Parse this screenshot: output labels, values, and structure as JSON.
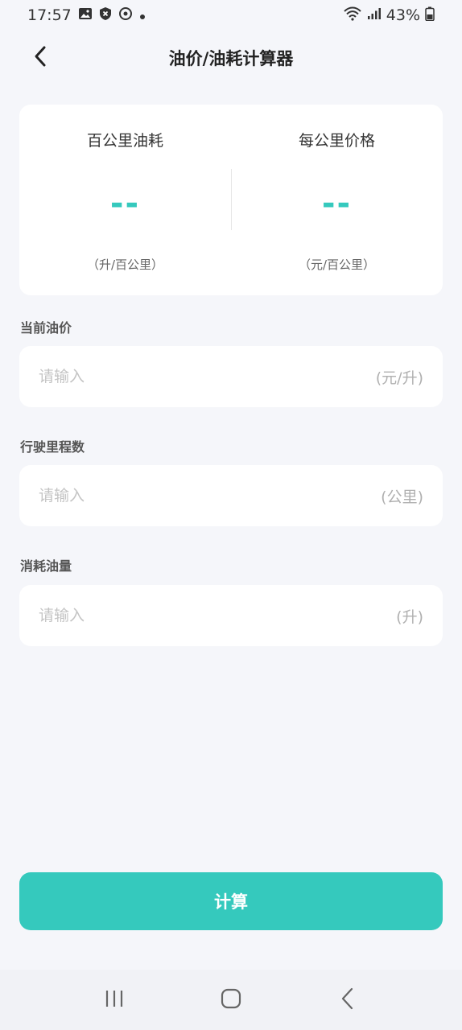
{
  "status_bar": {
    "time": "17:57",
    "battery": "43%",
    "icons": [
      "image-icon",
      "shield-icon",
      "sync-icon",
      "dot-icon",
      "wifi-icon",
      "signal-icon",
      "battery-icon"
    ]
  },
  "header": {
    "title": "油价/油耗计算器",
    "back_icon": "chevron-left-icon"
  },
  "results": {
    "consumption": {
      "label": "百公里油耗",
      "value": "--",
      "unit": "（升/百公里）"
    },
    "price": {
      "label": "每公里价格",
      "value": "--",
      "unit": "（元/百公里）"
    }
  },
  "fields": [
    {
      "label": "当前油价",
      "placeholder": "请输入",
      "unit": "(元/升)",
      "value": ""
    },
    {
      "label": "行驶里程数",
      "placeholder": "请输入",
      "unit": "(公里)",
      "value": ""
    },
    {
      "label": "消耗油量",
      "placeholder": "请输入",
      "unit": "(升)",
      "value": ""
    }
  ],
  "calculate_button": {
    "label": "计算"
  },
  "colors": {
    "accent": "#35c9bd",
    "background": "#f5f6fa"
  },
  "nav_bar": {
    "icons": [
      "recent-apps-icon",
      "home-icon",
      "back-icon"
    ]
  }
}
